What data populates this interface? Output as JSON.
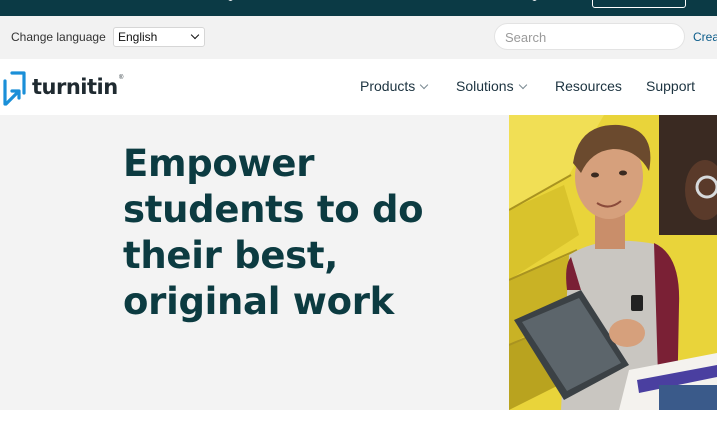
{
  "topbar": {
    "decorative_glyph": "partial-text-glyph",
    "button_label": ""
  },
  "utility": {
    "language_label": "Change language",
    "language_selected": "English",
    "search_placeholder": "Search",
    "create_link": "Crea"
  },
  "nav": {
    "logo_text": "turnitin",
    "logo_tm": "®",
    "items": [
      {
        "label": "Products",
        "has_dropdown": true
      },
      {
        "label": "Solutions",
        "has_dropdown": true
      },
      {
        "label": "Resources",
        "has_dropdown": false
      },
      {
        "label": "Support",
        "has_dropdown": false
      }
    ]
  },
  "hero": {
    "title_line1": "Empower",
    "title_line2": "students to do",
    "title_line3": "their best,",
    "title_line4": "original work",
    "image_subject": "students-with-tablet-on-yellow-stairs"
  },
  "colors": {
    "topbar": "#0b3a45",
    "utility_bg": "#f2f2f2",
    "hero_bg": "#f3f3f3",
    "hero_text": "#0c3b41",
    "brand_blue": "#1a8fd8",
    "link": "#0b5c8a"
  }
}
